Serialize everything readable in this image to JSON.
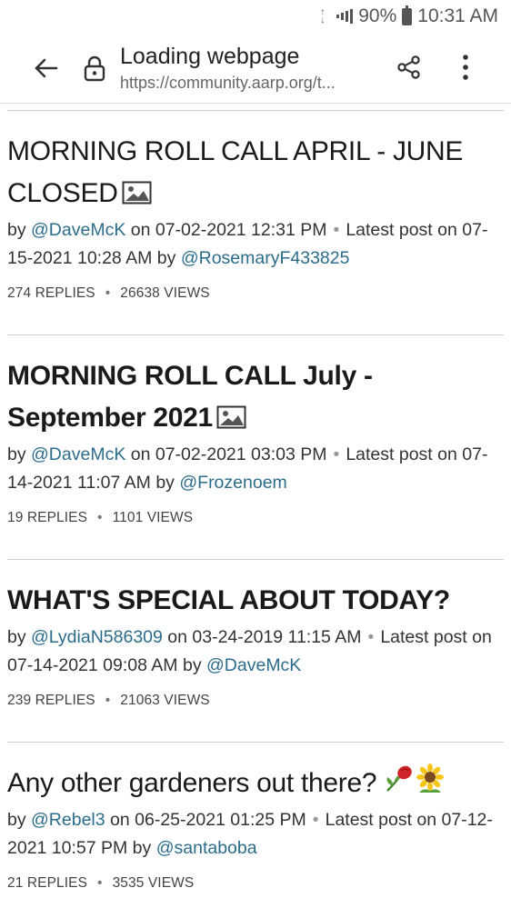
{
  "status_bar": {
    "battery": "90%",
    "time": "10:31 AM"
  },
  "toolbar": {
    "title": "Loading webpage",
    "url": "https://community.aarp.org/t..."
  },
  "threads": [
    {
      "title": "MORNING ROLL CALL APRIL - JUNE CLOSED",
      "bold": false,
      "has_image": true,
      "by": "by ",
      "author": "@DaveMcK",
      "on": " on 07-02-2021 12:31 PM",
      "latest": "Latest post on 07-15-2021 10:28 AM by ",
      "latest_author": "@RosemaryF433825",
      "replies": "274 REPLIES",
      "views": "26638 VIEWS"
    },
    {
      "title": "MORNING ROLL CALL July - September 2021",
      "bold": true,
      "has_image": true,
      "by": "by ",
      "author": "@DaveMcK",
      "on": " on 07-02-2021 03:03 PM",
      "latest": "Latest post on 07-14-2021 11:07 AM by ",
      "latest_author": "@Frozenoem",
      "replies": "19 REPLIES",
      "views": "1101 VIEWS"
    },
    {
      "title": "WHAT'S SPECIAL ABOUT TODAY?",
      "bold": true,
      "has_image": false,
      "by": "by ",
      "author": "@LydiaN586309",
      "on": " on 03-24-2019 11:15 AM",
      "latest": "Latest post on 07-14-2021 09:08 AM by ",
      "latest_author": "@DaveMcK",
      "replies": "239 REPLIES",
      "views": "21063 VIEWS"
    },
    {
      "title": "Any other gardeners out there?",
      "bold": false,
      "has_image": false,
      "emojis": [
        "rose-emoji",
        "sunflower-emoji"
      ],
      "by": "by ",
      "author": "@Rebel3",
      "on": " on 06-25-2021 01:25 PM",
      "latest": "Latest post on 07-12-2021 10:57 PM by ",
      "latest_author": "@santaboba",
      "replies": "21 REPLIES",
      "views": "3535 VIEWS"
    }
  ]
}
